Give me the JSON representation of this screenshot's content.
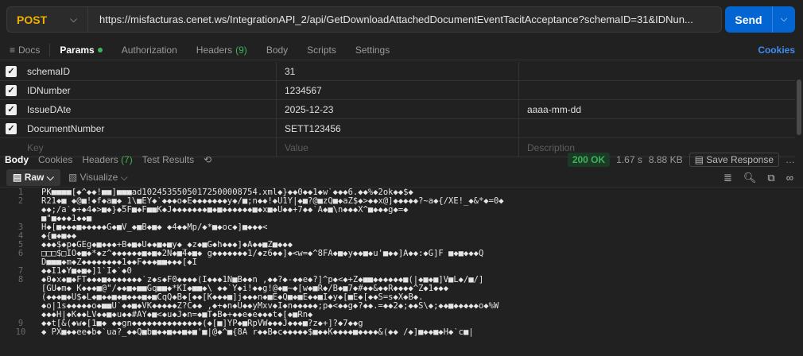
{
  "request": {
    "method": "POST",
    "url": "https://misfacturas.cenet.ws/IntegrationAPI_2/api/GetDownloadAttachedDocumentEventTacitAcceptance?schemaID=31&IDNun...",
    "send_label": "Send"
  },
  "tabs": {
    "docs": "Docs",
    "params": "Params",
    "authorization": "Authorization",
    "headers": "Headers",
    "headers_count": "(9)",
    "body": "Body",
    "scripts": "Scripts",
    "settings": "Settings",
    "cookies": "Cookies"
  },
  "params": [
    {
      "key": "schemaID",
      "value": "31",
      "description": ""
    },
    {
      "key": "IDNumber",
      "value": "1234567",
      "description": ""
    },
    {
      "key": "IssueDAte",
      "value": "2025-12-23",
      "description": "aaaa-mm-dd"
    },
    {
      "key": "DocumentNumber",
      "value": "SETT123456",
      "description": ""
    }
  ],
  "params_placeholder": {
    "key": "Key",
    "value": "Value",
    "description": "Description"
  },
  "response": {
    "tab_body": "Body",
    "tab_cookies": "Cookies",
    "tab_headers": "Headers",
    "headers_count": "(7)",
    "tab_tests": "Test Results",
    "status": "200 OK",
    "time": "1.67 s",
    "size": "8.88 KB",
    "save": "Save Response",
    "view_raw": "Raw",
    "view_visualize": "Visualize"
  },
  "code_lines": [
    {
      "n": "1",
      "t": "PK■■■■[◆^◆◆!■■]■■■ad10245355050172500008754.xml◆}◆◆0◆◆1◆w`◆◆◆6.◆◆%◆2ok◆◆$◆"
    },
    {
      "n": "2",
      "t": "R21◆■ ◆@■!◆f◆a■◆_1\\■EY◆`◆◆◆o◆E◆◆◆◆◆◆◆y◆/■;n◆◆!◆U1Y|◆■?@■zQ■◆aZ$◆>◆◆x@]◆◆◆◆◆?~a◆{/XE!_◆&*◆=0◆"
    },
    {
      "n": "",
      "t": "◆◆;/a`◆+◆4◆>■◆}◆5F■◆F■■K◆J◆◆◆◆◆◆◆■◆■◆◆◆◆◆◆■◆x■◆U◆◆+7◆◆`A◆■\\n◆◆◆X^■◆◆◆g◆=◆"
    },
    {
      "n": "",
      "t": "■\"■◆◆◆1◆◆■"
    },
    {
      "n": "3",
      "t": "H◆[■◆◆◆■◆◆◆◆◆G◆■V_◆■B◆■◆ ◆4◆◆Mp/◆*■◆oc◆]■◆◆◆<"
    },
    {
      "n": "4",
      "t": "◆{■◆■◆◆"
    },
    {
      "n": "5",
      "t": "◆◆◆$◆p◆GEg◆■◆◆◆+B◆■◆U◆◆■◆■y◆_◆z◆■G◆h◆◆◆]◆A◆◆■Z■◆◆◆"
    },
    {
      "n": "6",
      "t": "□□□$□IO◆■◆*◆z^◆◆◆◆◆◆■◆■◆2N◆■4◆■◆ g◆◆◆◆◆◆◆1/◆z6◆◆]◆<w=◆^8FA◆■◆y◆◆■◆u'■◆◆]A◆◆:◆G]F ■◆■◆◆◆Q"
    },
    {
      "n": "",
      "t": "D■■■◆m◆Z◆◆◆◆◆◆◆◆1◆◆F◆◆◆■■◆◆◆[◆I"
    },
    {
      "n": "7",
      "t": "◆◆I1◆Y■◆■◆]1`I◆`◆0"
    },
    {
      "n": "8",
      "t": "◆0◆x◆■◆FT◆◆◆■◆◆◆◆◆◆◆`z◆s◆F0◆◆◆◆(I◆◆◆1N■B◆◆n ,◆◆?◆-◆◆e◆?]^p◆<◆+Z◆■■◆◆◆◆◆◆■(|◆■◆■]V■L◆/■/]"
    },
    {
      "n": "",
      "t": "[GU◆m◆ K◆◆◆■@\"/◆◆■◆■■Gq■■◆*KI◆■■◆\\ ◆◆`Y◆i!◆◆g!@◆■~◆[w◆■R◆/B◆■7◆#◆◆&◆◆R◆◆◆◆^Z◆1◆◆◆"
    },
    {
      "n": "",
      "t": "(◆◆◆■◆U$◆L◆■◆◆■◆■◆◆◆■◆■CqQ◆B◆[◆◆[K◆◆◆■]j◆◆◆n◆■E◆Q■◆■E◆◆■I◆y◆[■E◆[◆◆S=s◆X◆B◆."
    },
    {
      "n": "",
      "t": "◆o|1s◆◆◆◆◆o◆■■U`◆◆■◆VK◆◆◆◆◆Z?C◆◆ ,◆+◆n◆U◆◆yMxv◆I◆n◆◆◆◆◆;p◆<◆◆g◆?◆◆.=◆◆2◆;◆◆S\\◆;◆◆■◆◆◆◆◆o◆%W"
    },
    {
      "n": "",
      "t": "◆◆◆H|◆K◆◆LV◆◆■◆u◆◆#AY◆■<◆u◆J◆n=◆■T◆B◆+◆◆e◆e◆◆◆t◆[◆■Rn◆"
    },
    {
      "n": "9",
      "t": "◆◆t[&(◆w◆[1■◆ ◆◆gn◆◆◆◆◆◆◆◆◆◆◆◆◆◆(◆[■]YP◆■RpVW◆◆◆J◆◆◆■?z◆+]?◆7◆◆g"
    },
    {
      "n": "10",
      "t": "◆ PX■◆◆ee◆b◆`ua?_◆◆Q■b■◆◆■◆◆■◆■'■|@◆^■{8A r◆◆B◆c◆◆◆◆◆$■◆◆K◆◆◆◆■◆◆◆◆&(◆◆ /◆]■◆◆■◆H◆`c■|"
    }
  ]
}
